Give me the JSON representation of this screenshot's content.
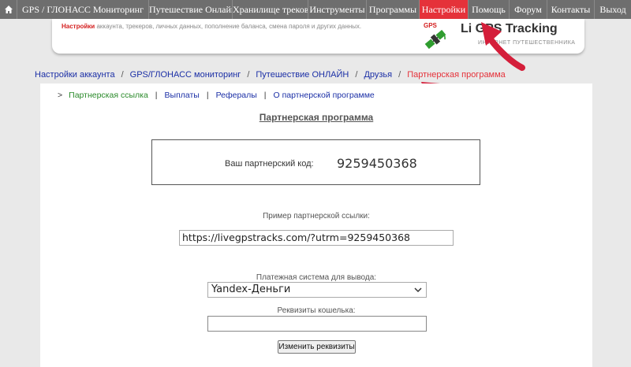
{
  "topnav": {
    "home_icon": "home-icon",
    "items": [
      {
        "label": "GPS / ГЛОНАСС Мониторинг"
      },
      {
        "label": "Путешествие Онлайн"
      },
      {
        "label": "Хранилище треков"
      },
      {
        "label": "Инструменты"
      },
      {
        "label": "Программы"
      },
      {
        "label": "Настройки",
        "active": true
      },
      {
        "label": "Помощь"
      },
      {
        "label": "Форум"
      },
      {
        "label": "Контакты"
      },
      {
        "label": "Выход"
      }
    ]
  },
  "header": {
    "desc_highlight": "Настройки",
    "desc_text": " аккаунта, трекеров, личных данных, пополнение баланса, смена пароля и других данных.",
    "logo_gps": "GPS",
    "logo_title": "Li GPS Tracking",
    "logo_sub": "ИНТЕРНЕТ ПУТЕШЕСТВЕННИКА"
  },
  "breadcrumb": {
    "items": [
      "Настройки аккаунта",
      "GPS/ГЛОНАСС мониторинг",
      "Путешествие ОНЛАЙН",
      "Друзья"
    ],
    "current": "Партнерская программа"
  },
  "subnav": {
    "bullet": ">",
    "items": [
      "Партнерская ссылка",
      "Выплаты",
      "Рефералы",
      "О партнерской программе"
    ]
  },
  "main": {
    "title": "Партнерская программа",
    "code_label": "Ваш партнерский код:",
    "code_value": "9259450368",
    "link_label": "Пример партнерской ссылки:",
    "link_value": "https://livegpstracks.com/?utrm=9259450368",
    "payment_label": "Платежная система для вывода:",
    "payment_selected": "Yandex-Деньги",
    "wallet_label": "Реквизиты кошелька:",
    "wallet_value": "",
    "submit_label": "Изменить реквизиты"
  },
  "colors": {
    "accent_red": "#e5323a",
    "nav_gray": "#6e6e6e",
    "link_blue": "#1b2fa6",
    "active_green": "#2a8a2a"
  }
}
